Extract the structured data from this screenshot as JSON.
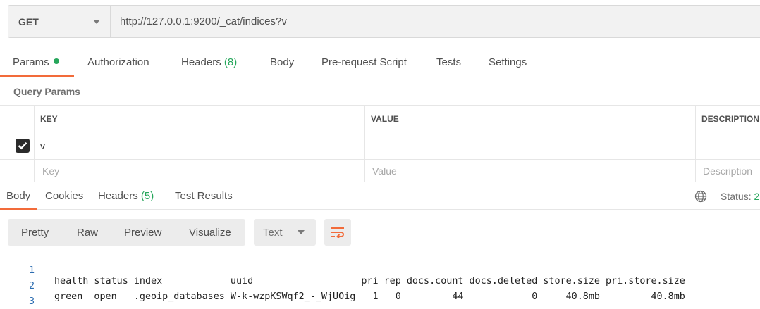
{
  "request": {
    "method": "GET",
    "url": "http://127.0.0.1:9200/_cat/indices?v"
  },
  "request_tabs": {
    "params": "Params",
    "authorization": "Authorization",
    "headers": "Headers",
    "headers_count": "(8)",
    "body": "Body",
    "prerequest": "Pre-request Script",
    "tests": "Tests",
    "settings": "Settings"
  },
  "query_params": {
    "title": "Query Params",
    "columns": {
      "key": "KEY",
      "value": "VALUE",
      "description": "DESCRIPTION"
    },
    "rows": [
      {
        "checked": true,
        "key": "v",
        "value": "",
        "description": ""
      }
    ],
    "placeholders": {
      "key": "Key",
      "value": "Value",
      "description": "Description"
    }
  },
  "response_tabs": {
    "body": "Body",
    "cookies": "Cookies",
    "headers": "Headers",
    "headers_count": "(5)",
    "test_results": "Test Results"
  },
  "status": {
    "label": "Status:",
    "code": "2"
  },
  "view": {
    "pretty": "Pretty",
    "raw": "Raw",
    "preview": "Preview",
    "visualize": "Visualize",
    "format": "Text"
  },
  "body_lines": [
    {
      "n": "1",
      "text": "health status index            uuid                   pri rep docs.count docs.deleted store.size pri.store.size"
    },
    {
      "n": "2",
      "text": "green  open   .geoip_databases W-k-wzpKSWqf2_-_WjUOig   1   0         44            0     40.8mb         40.8mb"
    },
    {
      "n": "3",
      "text": ""
    }
  ],
  "colors": {
    "accent": "#f26b3a",
    "green": "#26a65b",
    "line_number": "#2b6cb0"
  }
}
